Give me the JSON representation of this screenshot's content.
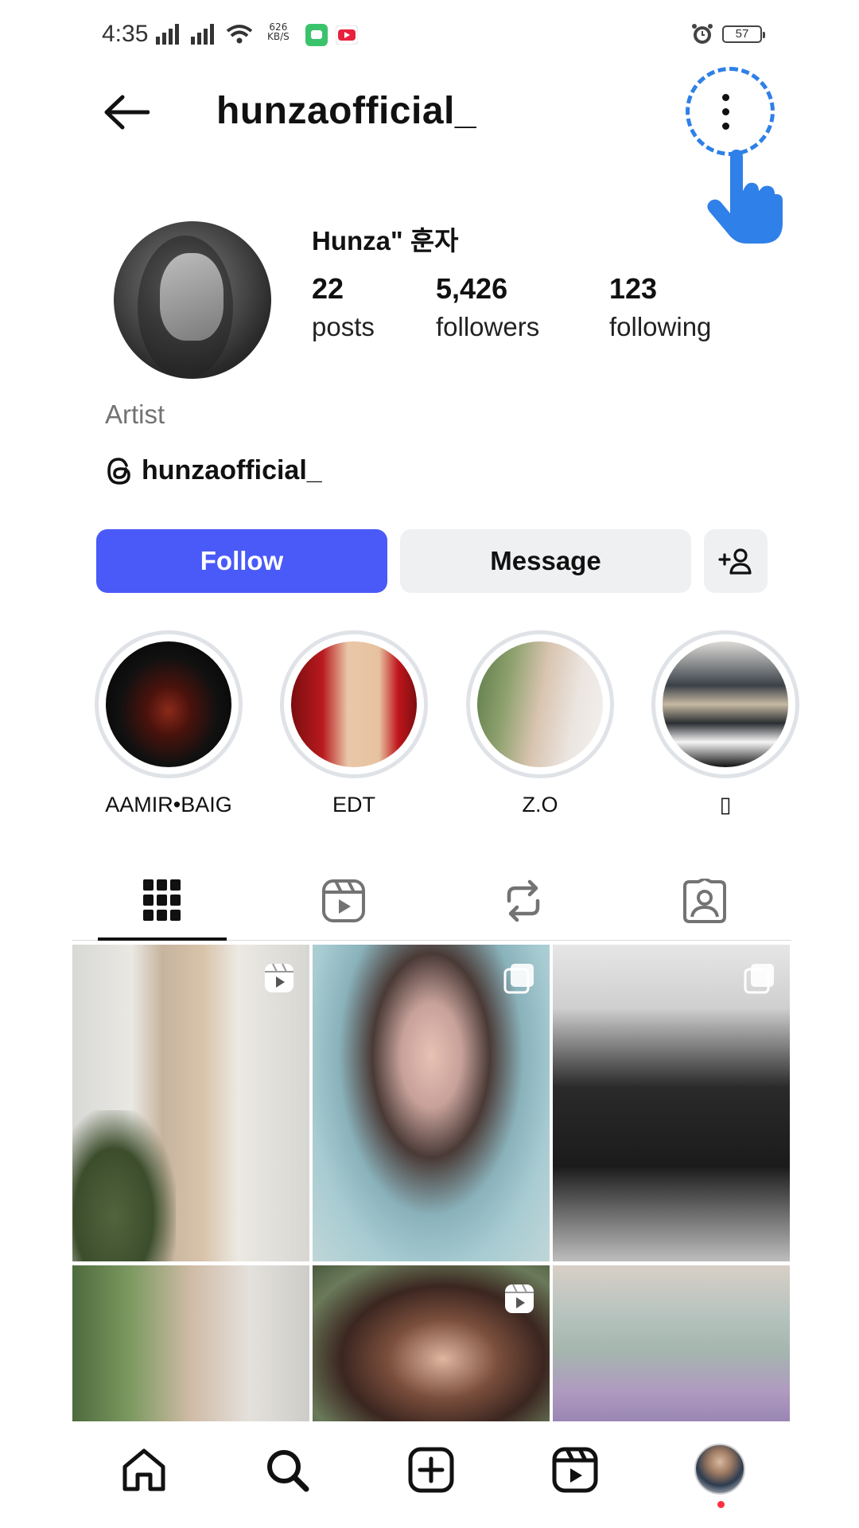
{
  "status_bar": {
    "time": "4:35",
    "net_speed_value": "626",
    "net_speed_unit": "KB/S",
    "battery": "57"
  },
  "header": {
    "username": "hunzaofficial_"
  },
  "profile": {
    "display_name": "Hunza\" 훈자",
    "stats": [
      {
        "value": "22",
        "label": "posts"
      },
      {
        "value": "5,426",
        "label": "followers"
      },
      {
        "value": "123",
        "label": "following"
      }
    ],
    "category": "Artist",
    "threads_handle": "hunzaofficial_"
  },
  "actions": {
    "follow_label": "Follow",
    "message_label": "Message"
  },
  "highlights": [
    {
      "label": "AAMIR•BAIG"
    },
    {
      "label": "EDT"
    },
    {
      "label": "Z.O"
    },
    {
      "label": "▯"
    }
  ],
  "tabs": [
    "posts-grid",
    "reels",
    "reposts",
    "tagged"
  ],
  "colors": {
    "follow_button": "#4a5af8",
    "secondary_button": "#eff0f2",
    "tutorial_highlight": "#2f80e8",
    "notification_dot": "#ff3040"
  }
}
